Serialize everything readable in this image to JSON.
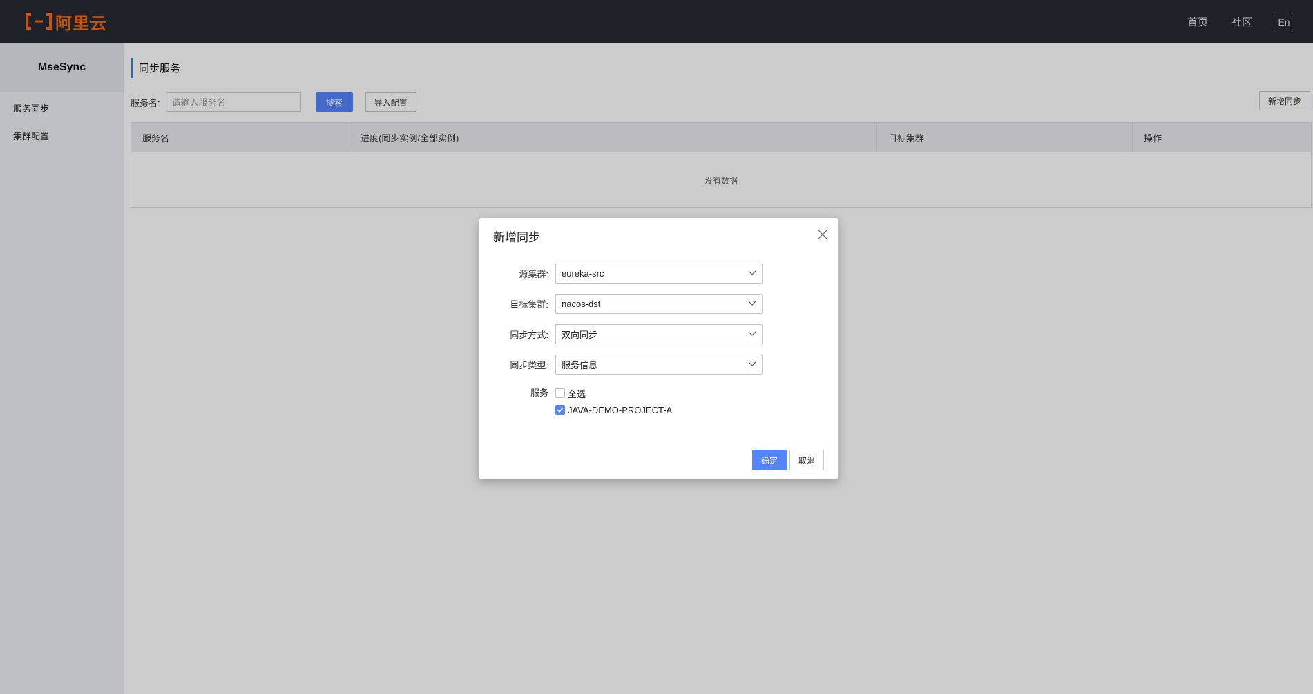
{
  "header": {
    "logo_text": "阿里云",
    "nav": [
      "首页",
      "社区"
    ],
    "lang_label": "En",
    "brand_color": "#ff6a00"
  },
  "sidebar": {
    "title": "MseSync",
    "items": [
      {
        "label": "服务同步"
      },
      {
        "label": "集群配置"
      }
    ]
  },
  "page": {
    "title": "同步服务",
    "search_label": "服务名:",
    "search_placeholder": "请输入服务名",
    "search_button": "搜索",
    "import_button": "导入配置",
    "add_button": "新增同步",
    "table": {
      "columns": [
        "服务名",
        "进度(同步实例/全部实例)",
        "目标集群",
        "操作"
      ],
      "empty_text": "没有数据"
    }
  },
  "dialog": {
    "title": "新增同步",
    "fields": [
      {
        "label": "源集群:",
        "value": "eureka-src"
      },
      {
        "label": "目标集群:",
        "value": "nacos-dst"
      },
      {
        "label": "同步方式:",
        "value": "双向同步"
      },
      {
        "label": "同步类型:",
        "value": "服务信息"
      }
    ],
    "services_label": "服务",
    "select_all_label": "全选",
    "select_all_checked": false,
    "services": [
      {
        "name": "JAVA-DEMO-PROJECT-A",
        "checked": true
      }
    ],
    "confirm_button": "确定",
    "cancel_button": "取消",
    "accent_color": "#5584ff"
  }
}
